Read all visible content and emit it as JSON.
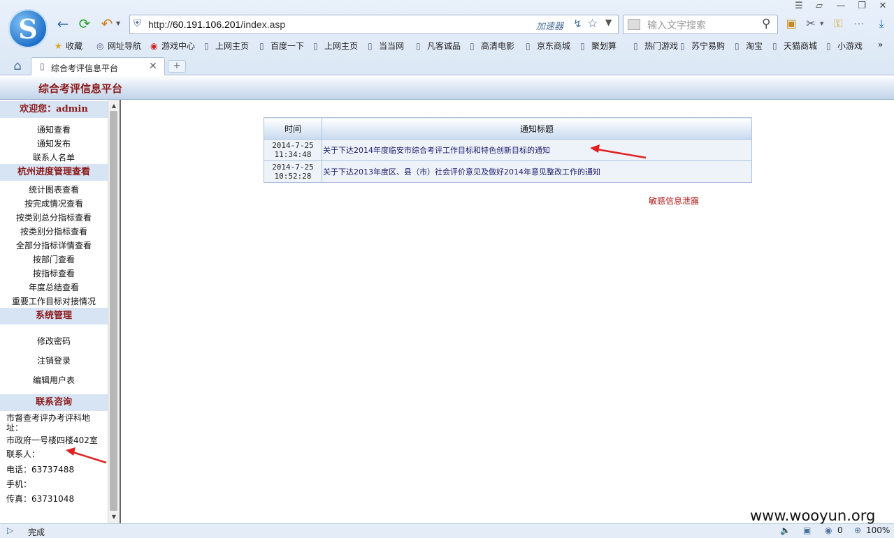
{
  "browser": {
    "url_prefix": "http://",
    "url_host": "60.191.106.201",
    "url_path": "/index.asp",
    "accelerator_label": "加速器",
    "search_placeholder": "输入文字搜索",
    "bookmarks": [
      "收藏",
      "网址导航",
      "游戏中心",
      "上网主页",
      "百度一下",
      "上网主页",
      "当当网",
      "凡客诚品",
      "高清电影",
      "京东商城",
      "聚划算",
      "热门游戏",
      "苏宁易购",
      "淘宝",
      "天猫商城",
      "小游戏"
    ],
    "tab_title": "综合考评信息平台",
    "status_text": "完成",
    "status_counter": "0",
    "zoom": "100%"
  },
  "page": {
    "title": "综合考评信息平台"
  },
  "sidebar": {
    "welcome": "欢迎您：admin",
    "group1": [
      "通知查看",
      "通知发布",
      "联系人名单"
    ],
    "section2_title": "杭州进度管理查看",
    "group2": [
      "统计图表查看",
      "按完成情况查看",
      "按类别总分指标查看",
      "按类别分指标查看",
      "全部分指标详情查看",
      "按部门查看",
      "按指标查看",
      "年度总结查看",
      "重要工作目标对接情况"
    ],
    "section3_title": "系统管理",
    "group3": [
      "修改密码",
      "注销登录",
      "编辑用户表"
    ],
    "section4_title": "联系咨询",
    "contact": {
      "address_label": "市督查考评办考评科地址：",
      "address": "市政府一号楼四楼402室",
      "person": "联系人：",
      "phone": "电话：63737488",
      "mobile": "手机：",
      "fax": "传真：63731048"
    }
  },
  "notices": {
    "headers": [
      "时间",
      "通知标题"
    ],
    "rows": [
      {
        "date": "2014-7-25",
        "time": "11:34:48",
        "title": "关于下达2014年度临安市综合考评工作目标和特色创新目标的通知"
      },
      {
        "date": "2014-7-25",
        "time": "10:52:28",
        "title": "关于下达2013年度区、县（市）社会评价意见及做好2014年意见整改工作的通知"
      }
    ]
  },
  "annotation": {
    "text": "敏感信息泄露",
    "color": "#e02020"
  },
  "watermark": "www.wooyun.org"
}
